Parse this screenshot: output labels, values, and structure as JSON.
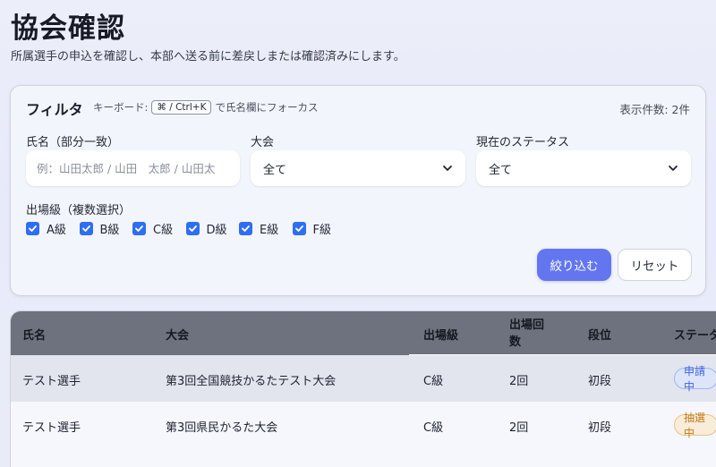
{
  "page": {
    "title": "協会確認",
    "description": "所属選手の申込を確認し、本部へ送る前に差戻しまたは確認済みにします。"
  },
  "filter": {
    "title": "フィルタ",
    "kbd_prefix": "キーボード:",
    "kbd_keys": "⌘ / Ctrl+K",
    "kbd_suffix": "で氏名欄にフォーカス",
    "result_count": "表示件数: 2件",
    "name_label": "氏名（部分一致）",
    "name_placeholder": "例：山田太郎 / 山田　太郎 / 山田太",
    "name_value": "",
    "tournament_label": "大会",
    "tournament_value": "全て",
    "status_label": "現在のステータス",
    "status_value": "全て",
    "grade_label": "出場級（複数選択）",
    "grades": [
      {
        "label": "A級",
        "checked": true
      },
      {
        "label": "B級",
        "checked": true
      },
      {
        "label": "C級",
        "checked": true
      },
      {
        "label": "D級",
        "checked": true
      },
      {
        "label": "E級",
        "checked": true
      },
      {
        "label": "F級",
        "checked": true
      }
    ],
    "apply_label": "絞り込む",
    "reset_label": "リセット"
  },
  "table": {
    "headers": {
      "name": "氏名",
      "tournament": "大会",
      "grade": "出場級",
      "count_line1": "出場回",
      "count_line2": "数",
      "rank": "段位",
      "status": "ステータス"
    },
    "rows": [
      {
        "name": "テスト選手",
        "tournament": "第3回全国競技かるたテスト大会",
        "grade": "C級",
        "count": "2回",
        "rank": "初段",
        "status": "申請中"
      },
      {
        "name": "テスト選手",
        "tournament": "第3回県民かるた大会",
        "grade": "C級",
        "count": "2回",
        "rank": "初段",
        "status": "抽選中"
      }
    ]
  },
  "colors": {
    "primary": "#6376f0",
    "checkbox": "#2e6ef0",
    "header_bg": "#6e727e",
    "badge_blue": "#3f63d8",
    "badge_orange": "#c27a1e"
  }
}
